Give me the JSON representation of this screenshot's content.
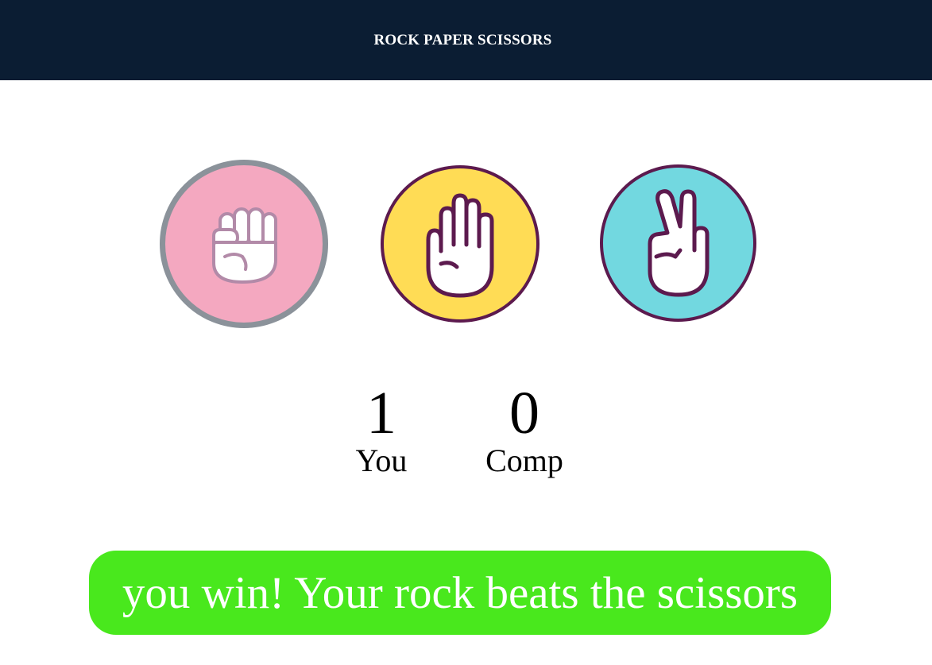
{
  "header": {
    "title": "ROCK PAPER SCISSORS"
  },
  "choices": [
    {
      "name": "rock",
      "icon": "fist-icon",
      "color": "#f4a8c0",
      "selected": true
    },
    {
      "name": "paper",
      "icon": "open-hand-icon",
      "color": "#ffdc55",
      "selected": false
    },
    {
      "name": "scissors",
      "icon": "peace-hand-icon",
      "color": "#72d8e0",
      "selected": false
    }
  ],
  "scores": {
    "user": {
      "value": "1",
      "label": "You"
    },
    "comp": {
      "value": "0",
      "label": "Comp"
    }
  },
  "result": {
    "message": "you win! Your rock beats the scissors",
    "color": "#49e81d"
  },
  "colors": {
    "header_bg": "#0b1d33",
    "outline": "#5c1a4e",
    "selected_ring": "#8b929a"
  }
}
